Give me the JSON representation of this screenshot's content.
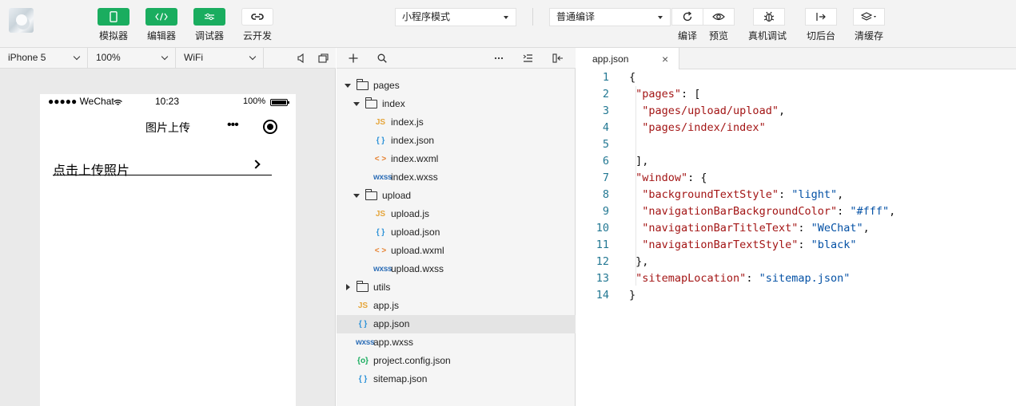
{
  "toolbar": {
    "buttons": [
      {
        "label": "模拟器",
        "icon": "phone-icon",
        "style": "green"
      },
      {
        "label": "编辑器",
        "icon": "code-icon",
        "style": "green"
      },
      {
        "label": "调试器",
        "icon": "sliders-icon",
        "style": "green"
      },
      {
        "label": "云开发",
        "icon": "cloud-link-icon",
        "style": "white"
      }
    ],
    "mode_select": "小程序模式",
    "compile_select": "普通编译",
    "actions": [
      {
        "label": "编译",
        "icon": "refresh-icon"
      },
      {
        "label": "预览",
        "icon": "eye-icon"
      },
      {
        "label": "真机调试",
        "icon": "bug-icon"
      },
      {
        "label": "切后台",
        "icon": "background-icon"
      },
      {
        "label": "清缓存",
        "icon": "layers-icon"
      }
    ]
  },
  "simulator": {
    "device": "iPhone 5",
    "zoom": "100%",
    "network": "WiFi",
    "status_bar": {
      "carrier": "●●●●● WeChat",
      "time": "10:23",
      "battery": "100%"
    },
    "page_title": "图片上传",
    "capsule_dots": "•••",
    "upload_label": "点击上传照片"
  },
  "file_tree": {
    "nodes": [
      {
        "name": "pages",
        "type": "folder",
        "depth": 0,
        "expanded": true
      },
      {
        "name": "index",
        "type": "folder",
        "depth": 1,
        "expanded": true
      },
      {
        "name": "index.js",
        "type": "js",
        "depth": 2
      },
      {
        "name": "index.json",
        "type": "json",
        "depth": 2
      },
      {
        "name": "index.wxml",
        "type": "wxml",
        "depth": 2
      },
      {
        "name": "index.wxss",
        "type": "wxss",
        "depth": 2
      },
      {
        "name": "upload",
        "type": "folder",
        "depth": 1,
        "expanded": true
      },
      {
        "name": "upload.js",
        "type": "js",
        "depth": 2
      },
      {
        "name": "upload.json",
        "type": "json",
        "depth": 2
      },
      {
        "name": "upload.wxml",
        "type": "wxml",
        "depth": 2
      },
      {
        "name": "upload.wxss",
        "type": "wxss",
        "depth": 2
      },
      {
        "name": "utils",
        "type": "folder",
        "depth": 0,
        "expanded": false
      },
      {
        "name": "app.js",
        "type": "js",
        "depth": 0
      },
      {
        "name": "app.json",
        "type": "json",
        "depth": 0,
        "active": true
      },
      {
        "name": "app.wxss",
        "type": "wxss",
        "depth": 0
      },
      {
        "name": "project.config.json",
        "type": "config",
        "depth": 0
      },
      {
        "name": "sitemap.json",
        "type": "json",
        "depth": 0
      }
    ],
    "icon_glyphs": {
      "js": "JS",
      "json": "{ }",
      "wxml": "< >",
      "wxss": "wxss",
      "config": "{o}"
    }
  },
  "editor": {
    "tab_name": "app.json",
    "close_glyph": "×",
    "lines": [
      [
        {
          "t": "p",
          "s": "{"
        }
      ],
      [
        {
          "t": "p",
          "s": " "
        },
        {
          "t": "k",
          "s": "\"pages\""
        },
        {
          "t": "p",
          "s": ": ["
        }
      ],
      [
        {
          "t": "p",
          "s": "  "
        },
        {
          "t": "k",
          "s": "\"pages/upload/upload\""
        },
        {
          "t": "p",
          "s": ","
        }
      ],
      [
        {
          "t": "p",
          "s": "  "
        },
        {
          "t": "k",
          "s": "\"pages/index/index\""
        }
      ],
      [],
      [
        {
          "t": "p",
          "s": " ],"
        }
      ],
      [
        {
          "t": "p",
          "s": " "
        },
        {
          "t": "k",
          "s": "\"window\""
        },
        {
          "t": "p",
          "s": ": {"
        }
      ],
      [
        {
          "t": "p",
          "s": "  "
        },
        {
          "t": "k",
          "s": "\"backgroundTextStyle\""
        },
        {
          "t": "p",
          "s": ": "
        },
        {
          "t": "v",
          "s": "\"light\""
        },
        {
          "t": "p",
          "s": ","
        }
      ],
      [
        {
          "t": "p",
          "s": "  "
        },
        {
          "t": "k",
          "s": "\"navigationBarBackgroundColor\""
        },
        {
          "t": "p",
          "s": ": "
        },
        {
          "t": "v",
          "s": "\"#fff\""
        },
        {
          "t": "p",
          "s": ","
        }
      ],
      [
        {
          "t": "p",
          "s": "  "
        },
        {
          "t": "k",
          "s": "\"navigationBarTitleText\""
        },
        {
          "t": "p",
          "s": ": "
        },
        {
          "t": "v",
          "s": "\"WeChat\""
        },
        {
          "t": "p",
          "s": ","
        }
      ],
      [
        {
          "t": "p",
          "s": "  "
        },
        {
          "t": "k",
          "s": "\"navigationBarTextStyle\""
        },
        {
          "t": "p",
          "s": ": "
        },
        {
          "t": "v",
          "s": "\"black\""
        }
      ],
      [
        {
          "t": "p",
          "s": " },"
        }
      ],
      [
        {
          "t": "p",
          "s": " "
        },
        {
          "t": "k",
          "s": "\"sitemapLocation\""
        },
        {
          "t": "p",
          "s": ": "
        },
        {
          "t": "v",
          "s": "\"sitemap.json\""
        }
      ],
      [
        {
          "t": "p",
          "s": "}"
        }
      ]
    ]
  },
  "colors": {
    "green": "#1aad5f",
    "key": "#a31515",
    "value": "#0451a5",
    "line_number": "#237893"
  }
}
